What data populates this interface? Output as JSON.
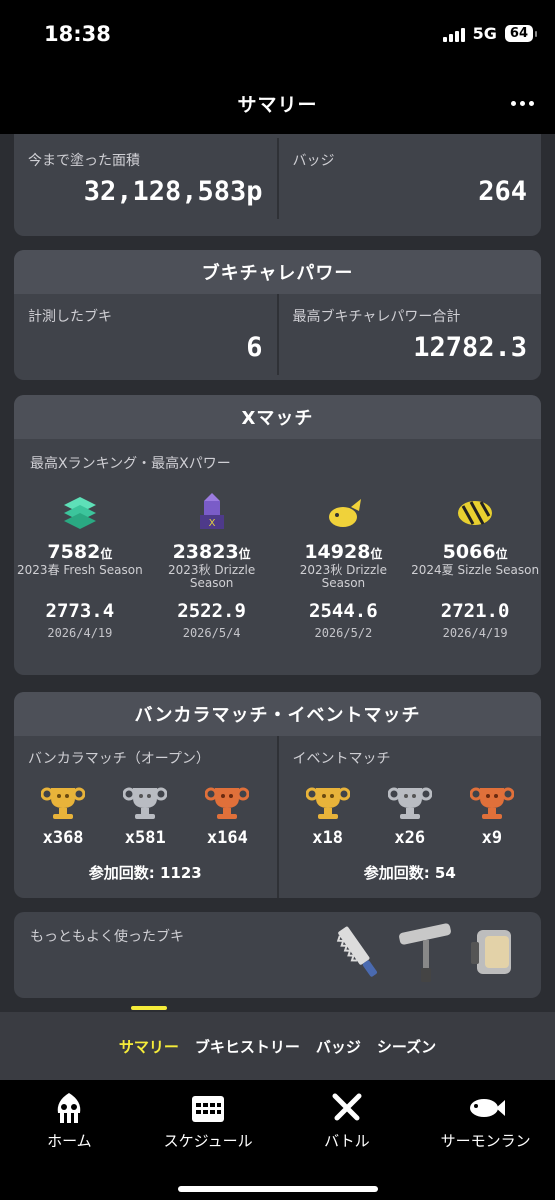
{
  "status": {
    "time": "18:38",
    "network": "5G",
    "battery": "64"
  },
  "header": {
    "title": "サマリー"
  },
  "stats": {
    "area_label": "今まで塗った面積",
    "area_value": "32,128,583p",
    "badge_label": "バッジ",
    "badge_value": "264"
  },
  "weapon_power": {
    "title": "ブキチャレパワー",
    "measured_label": "計測したブキ",
    "measured_value": "6",
    "max_label": "最高ブキチャレパワー合計",
    "max_value": "12782.3"
  },
  "x_match": {
    "title": "Xマッチ",
    "sub_label": "最高Xランキング・最高Xパワー",
    "rank_unit": "位",
    "entries": [
      {
        "icon": "fresh-season-icon",
        "rank": "7582",
        "season": "2023春 Fresh Season",
        "power": "2773.4",
        "date": "2026/4/19"
      },
      {
        "icon": "drizzle-tower-icon",
        "rank": "23823",
        "season": "2023秋 Drizzle Season",
        "power": "2522.9",
        "date": "2026/5/4"
      },
      {
        "icon": "drizzle-fish-icon",
        "rank": "14928",
        "season": "2023秋 Drizzle Season",
        "power": "2544.6",
        "date": "2026/5/2"
      },
      {
        "icon": "sizzle-season-icon",
        "rank": "5066",
        "season": "2024夏 Sizzle Season",
        "power": "2721.0",
        "date": "2026/4/19"
      }
    ]
  },
  "anarchy": {
    "title": "バンカラマッチ・イベントマッチ",
    "open": {
      "label": "バンカラマッチ（オープン）",
      "gold": "x368",
      "silver": "x581",
      "bronze": "x164",
      "participation": "参加回数: 1123"
    },
    "event": {
      "label": "イベントマッチ",
      "gold": "x18",
      "silver": "x26",
      "bronze": "x9",
      "participation": "参加回数: 54"
    }
  },
  "most_used": {
    "label": "もっともよく使ったブキ"
  },
  "tabs": [
    "サマリー",
    "ブキヒストリー",
    "バッジ",
    "シーズン"
  ],
  "nav": [
    "ホーム",
    "スケジュール",
    "バトル",
    "サーモンラン"
  ],
  "colors": {
    "gold": "#e8b33a",
    "silver": "#b9bcc2",
    "bronze": "#e0703a",
    "accent": "#f5ec3a"
  }
}
